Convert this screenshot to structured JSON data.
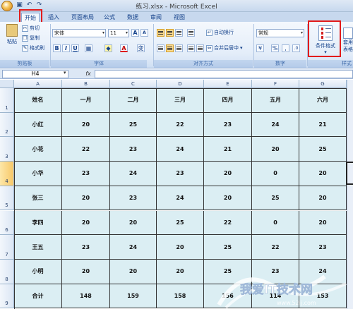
{
  "window": {
    "title": "练习.xlsx - Microsoft Excel",
    "qat_icons": [
      "save-icon",
      "undo-icon",
      "redo-icon"
    ]
  },
  "tabs": [
    {
      "label": "开始",
      "active": true
    },
    {
      "label": "插入",
      "active": false
    },
    {
      "label": "页面布局",
      "active": false
    },
    {
      "label": "公式",
      "active": false
    },
    {
      "label": "数据",
      "active": false
    },
    {
      "label": "审阅",
      "active": false
    },
    {
      "label": "视图",
      "active": false
    }
  ],
  "ribbon": {
    "clipboard": {
      "label": "剪贴板",
      "paste": "粘贴",
      "cut": "剪切",
      "copy": "复制",
      "format_painter": "格式刷"
    },
    "font": {
      "label": "字体",
      "font_name": "宋体",
      "font_size": "11",
      "bold": "B",
      "italic": "I",
      "underline": "U",
      "grow": "A",
      "shrink": "A",
      "wen": "变"
    },
    "alignment": {
      "label": "对齐方式",
      "wrap": "自动换行",
      "merge": "合并后居中"
    },
    "number": {
      "label": "数字",
      "format": "常规",
      "percent": "%",
      "comma": ","
    },
    "styles": {
      "conditional": "条件格式",
      "table_format": "套用",
      "table_format2": "表格格",
      "label_partial": "样式"
    }
  },
  "formula_bar": {
    "name_box": "H4",
    "fx": "fx",
    "content": ""
  },
  "columns": [
    "A",
    "B",
    "C",
    "D",
    "E",
    "F",
    "G"
  ],
  "rows": [
    "1",
    "2",
    "3",
    "4",
    "5",
    "6",
    "7",
    "8",
    "9"
  ],
  "selected_row": "4",
  "table": [
    [
      "姓名",
      "一月",
      "二月",
      "三月",
      "四月",
      "五月",
      "六月"
    ],
    [
      "小红",
      "20",
      "25",
      "22",
      "23",
      "24",
      "21"
    ],
    [
      "小花",
      "22",
      "23",
      "24",
      "21",
      "20",
      "25"
    ],
    [
      "小华",
      "23",
      "24",
      "23",
      "20",
      "0",
      "20"
    ],
    [
      "张三",
      "20",
      "23",
      "24",
      "20",
      "25",
      "20"
    ],
    [
      "李四",
      "20",
      "20",
      "25",
      "22",
      "0",
      "20"
    ],
    [
      "王五",
      "23",
      "24",
      "20",
      "25",
      "22",
      "23"
    ],
    [
      "小明",
      "20",
      "20",
      "20",
      "25",
      "23",
      "24"
    ],
    [
      "合计",
      "148",
      "159",
      "158",
      "156",
      "114",
      "153"
    ]
  ],
  "watermark": {
    "text": "我爱IT技术网",
    "sub": "www.52ij.com"
  }
}
